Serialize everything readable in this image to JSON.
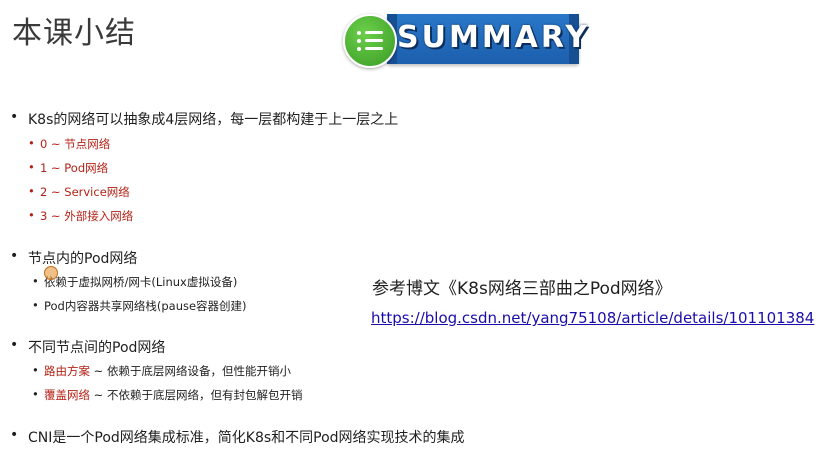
{
  "title": "本课小结",
  "logo": {
    "text": "SUMMARY",
    "icon": "list-icon"
  },
  "sections": [
    {
      "text": "K8s的网络可以抽象成4层网络，每一层都构建于上一层之上",
      "items": [
        {
          "text": "0 ~ 节点网络"
        },
        {
          "text": "1 ~ Pod网络"
        },
        {
          "text": "2 ~ Service网络"
        },
        {
          "text": "3 ~ 外部接入网络"
        }
      ]
    },
    {
      "text": "节点内的Pod网络",
      "items": [
        {
          "text": "依赖于虚拟网桥/网卡(Linux虚拟设备)"
        },
        {
          "text": "Pod内容器共享网络栈(pause容器创建)"
        }
      ]
    },
    {
      "text": "不同节点间的Pod网络",
      "items": [
        {
          "term": "路由方案",
          "text": " ~ 依赖于底层网络设备，但性能开销小"
        },
        {
          "term": "覆盖网络",
          "text": " ~ 不依赖于底层网络，但有封包解包开销"
        }
      ]
    },
    {
      "text": "CNI是一个Pod网络集成标准，简化K8s和不同Pod网络实现技术的集成"
    }
  ],
  "reference": {
    "title": "参考博文《K8s网络三部曲之Pod网络》",
    "url": "https://blog.csdn.net/yang75108/article/details/101101384"
  },
  "bullet_char": "•",
  "colors": {
    "accent_red": "#b42318",
    "link": "#1a0dab"
  }
}
